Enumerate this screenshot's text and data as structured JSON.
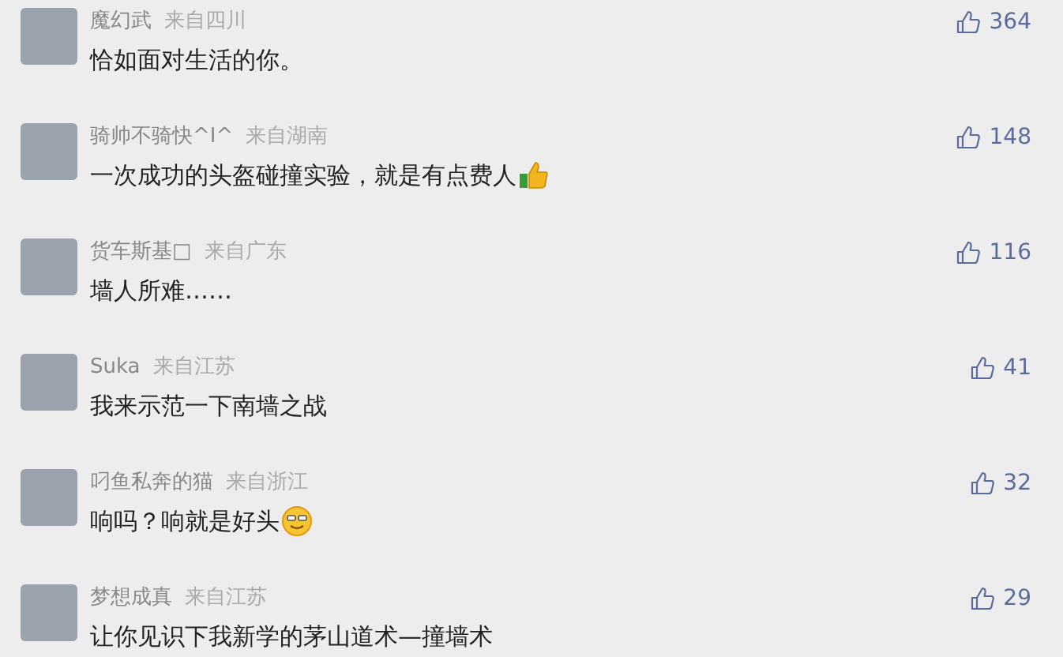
{
  "comments": [
    {
      "name": "魔幻武",
      "location": "来自四川",
      "text": "恰如面对生活的你。",
      "likes": "364"
    },
    {
      "name": "骑帅不骑快^I^",
      "location": "来自湖南",
      "text": "一次成功的头盔碰撞实验，就是有点费人",
      "emoji": {
        "kind": "thumbs-up"
      },
      "likes": "148"
    },
    {
      "name": "货车斯基□",
      "location": "来自广东",
      "text": "墙人所难……",
      "likes": "116"
    },
    {
      "name": "Suka",
      "location": "来自江苏",
      "text": "我来示范一下南墙之战",
      "likes": "41"
    },
    {
      "name": "叼鱼私奔的猫",
      "location": "来自浙江",
      "text": "响吗？响就是好头",
      "emoji": {
        "kind": "smiley"
      },
      "likes": "32"
    },
    {
      "name": "梦想成真",
      "location": "来自江苏",
      "text": "让你见识下我新学的茅山道术—撞墙术",
      "likes": "29"
    }
  ]
}
